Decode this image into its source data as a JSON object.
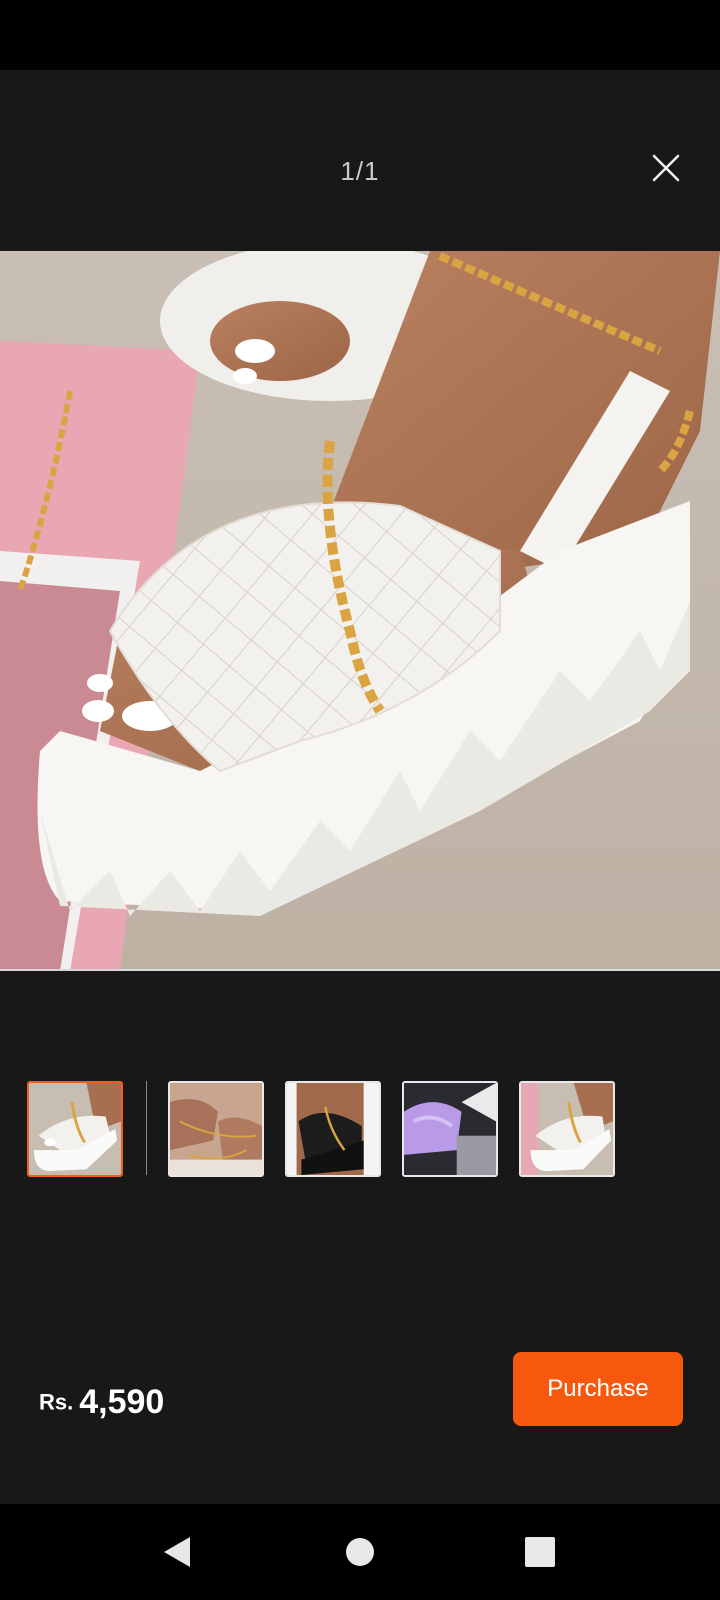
{
  "viewer": {
    "counter": "1/1",
    "close_icon": "close-icon"
  },
  "main_image": {
    "description_icon": "product-photo"
  },
  "thumbnails": [
    {
      "id": "thumb-1",
      "active": true
    },
    {
      "id": "thumb-2",
      "active": false
    },
    {
      "id": "thumb-3",
      "active": false
    },
    {
      "id": "thumb-4",
      "active": false
    },
    {
      "id": "thumb-5",
      "active": false
    }
  ],
  "footer": {
    "currency": "Rs.",
    "price": "4,590",
    "purchase_label": "Purchase"
  },
  "colors": {
    "accent": "#f6580d",
    "viewer_bg": "#181818",
    "active_thumb_border": "#f25c1c"
  },
  "nav": {
    "back_icon": "back-triangle-icon",
    "home_icon": "home-circle-icon",
    "recents_icon": "recents-square-icon"
  }
}
